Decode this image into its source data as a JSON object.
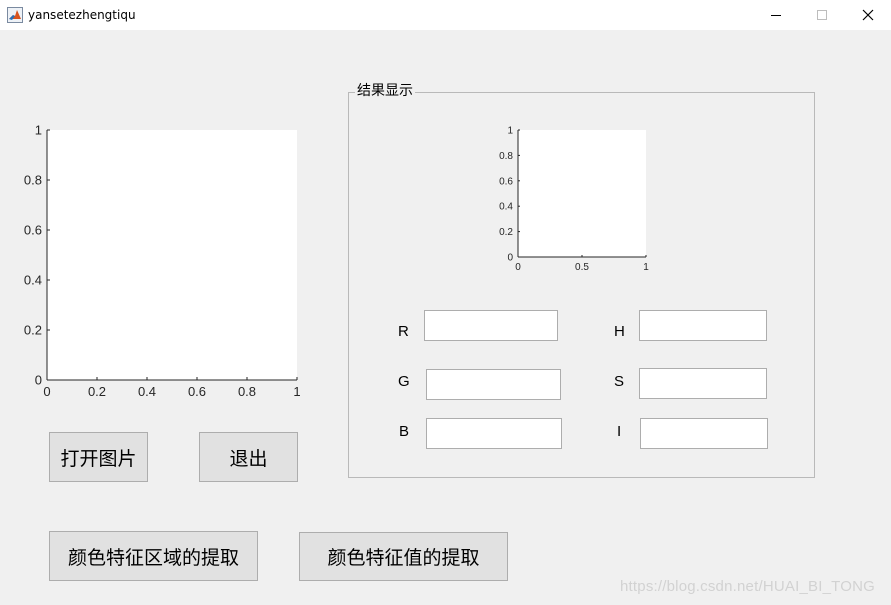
{
  "window": {
    "title": "yansetezhengtiqu",
    "icon": "matlab-icon",
    "controls": [
      "minimize-icon",
      "maximize-icon",
      "close-icon"
    ]
  },
  "main_axes": {
    "xticks": [
      "0",
      "0.2",
      "0.4",
      "0.6",
      "0.8",
      "1"
    ],
    "yticks": [
      "0",
      "0.2",
      "0.4",
      "0.6",
      "0.8",
      "1"
    ],
    "xlim": [
      0,
      1
    ],
    "ylim": [
      0,
      1
    ]
  },
  "result_panel": {
    "title": "结果显示",
    "axes": {
      "xticks": [
        "0",
        "0.5",
        "1"
      ],
      "yticks": [
        "0",
        "0.2",
        "0.4",
        "0.6",
        "0.8",
        "1"
      ],
      "xlim": [
        0,
        1
      ],
      "ylim": [
        0,
        1
      ]
    },
    "fields": [
      {
        "label": "R",
        "value": ""
      },
      {
        "label": "G",
        "value": ""
      },
      {
        "label": "B",
        "value": ""
      },
      {
        "label": "H",
        "value": ""
      },
      {
        "label": "S",
        "value": ""
      },
      {
        "label": "I",
        "value": ""
      }
    ]
  },
  "buttons": {
    "open_image": "打开图片",
    "exit": "退出",
    "extract_region": "颜色特征区域的提取",
    "extract_value": "颜色特征值的提取"
  },
  "watermark": "https://blog.csdn.net/HUAI_BI_TONG"
}
